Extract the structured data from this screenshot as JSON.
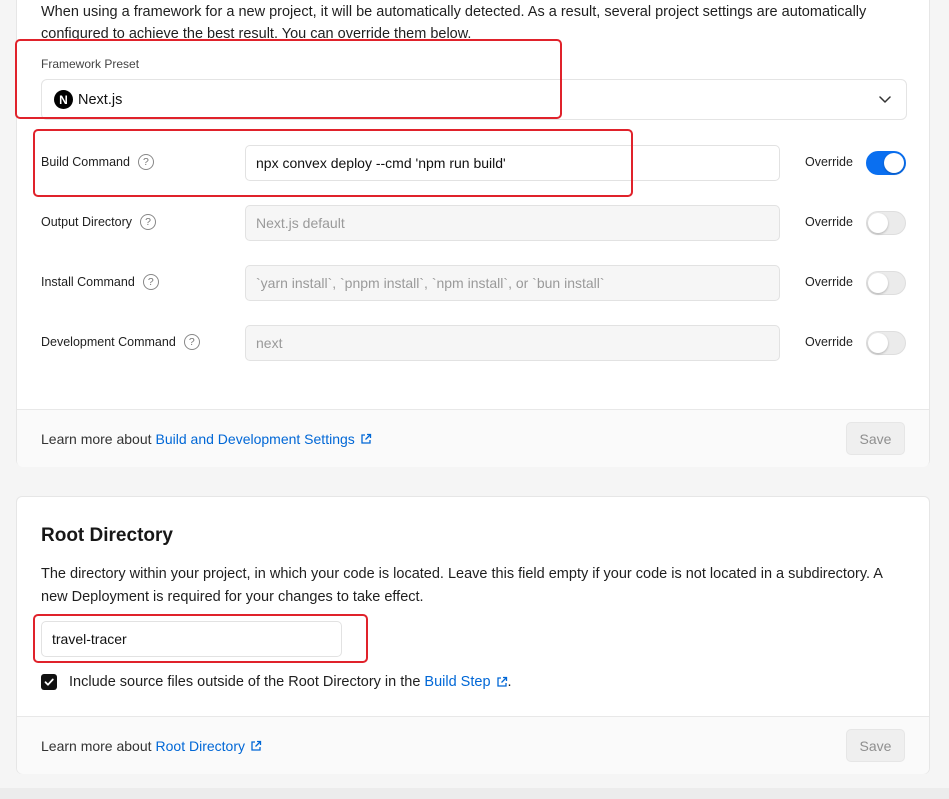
{
  "build_settings": {
    "intro": "When using a framework for a new project, it will be automatically detected. As a result, several project settings are automatically configured to achieve the best result. You can override them below.",
    "framework_preset": {
      "label": "Framework Preset",
      "value": "Next.js",
      "logo_letter": "N"
    },
    "override_label": "Override",
    "rows": [
      {
        "label": "Build Command",
        "value": "npx convex deploy --cmd 'npm run build'",
        "placeholder": "",
        "override": true
      },
      {
        "label": "Output Directory",
        "value": "",
        "placeholder": "Next.js default",
        "override": false
      },
      {
        "label": "Install Command",
        "value": "",
        "placeholder": "`yarn install`, `pnpm install`, `npm install`, or `bun install`",
        "override": false
      },
      {
        "label": "Development Command",
        "value": "",
        "placeholder": "next",
        "override": false
      }
    ],
    "footer": {
      "text": "Learn more about",
      "link": "Build and Development Settings",
      "save": "Save"
    }
  },
  "root_directory": {
    "title": "Root Directory",
    "description": "The directory within your project, in which your code is located. Leave this field empty if your code is not located in a subdirectory. A new Deployment is required for your changes to take effect.",
    "value": "travel-tracer",
    "checkbox": {
      "checked": true,
      "text": "Include source files outside of the Root Directory in the",
      "link": "Build Step",
      "suffix": "."
    },
    "footer": {
      "text": "Learn more about",
      "link": "Root Directory",
      "save": "Save"
    }
  },
  "colors": {
    "accent": "#0a6ff0",
    "link": "#0067d6",
    "highlight": "#e0222b"
  },
  "icons": {
    "help": "question-circle-icon",
    "external": "external-link-icon",
    "chevron": "chevron-down-icon",
    "check": "check-icon"
  }
}
